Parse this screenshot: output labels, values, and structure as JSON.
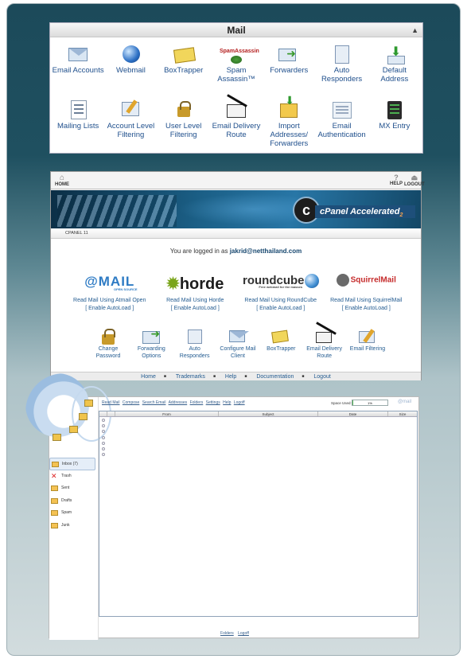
{
  "mail_panel": {
    "title": "Mail",
    "items": [
      {
        "label": "Email Accounts",
        "icon": "envelope-icon"
      },
      {
        "label": "Webmail",
        "icon": "globe-icon"
      },
      {
        "label": "BoxTrapper",
        "icon": "box-icon"
      },
      {
        "label": "Spam Assassin™",
        "icon": "spamassassin-icon",
        "icon_text": "SpamAssassin"
      },
      {
        "label": "Forwarders",
        "icon": "forward-envelope-icon"
      },
      {
        "label": "Auto Responders",
        "icon": "auto-responder-icon"
      },
      {
        "label": "Default Address",
        "icon": "download-icon"
      },
      {
        "label": "Mailing Lists",
        "icon": "mailing-list-icon"
      },
      {
        "label": "Account Level Filtering",
        "icon": "filter-pen-icon"
      },
      {
        "label": "User Level Filtering",
        "icon": "lock-icon"
      },
      {
        "label": "Email Delivery Route",
        "icon": "delivery-route-icon"
      },
      {
        "label": "Import Addresses/ Forwarders",
        "icon": "import-package-icon"
      },
      {
        "label": "Email Authentication",
        "icon": "authentication-icon"
      },
      {
        "label": "MX Entry",
        "icon": "server-icon"
      }
    ]
  },
  "webmail_chooser": {
    "home_label": "HOME",
    "help_label": "HELP",
    "logout_label": "LOGOUT",
    "banner_logo_text": "cPanel Accelerated",
    "banner_logo_sup": "2",
    "version": "CPANEL 11",
    "logged_in_prefix": "You are logged in as",
    "logged_in_user": "jakrid@netthailand.com",
    "clients": [
      {
        "logo": "@MAIL",
        "logo_sub": "OPEN SOURCE",
        "read": "Read Mail Using Atmail Open",
        "autoload": "[ Enable AutoLoad ]"
      },
      {
        "logo": "horde",
        "read": "Read Mail Using Horde",
        "autoload": "[ Enable AutoLoad ]"
      },
      {
        "logo": "roundcube",
        "logo_sub": "Free webmail for the masses",
        "read": "Read Mail Using RoundCube",
        "autoload": "[ Enable AutoLoad ]"
      },
      {
        "logo": "SquirrelMail",
        "read": "Read Mail Using SquirrelMail",
        "autoload": "[ Enable AutoLoad ]"
      }
    ],
    "tools": [
      {
        "label": "Change Password",
        "icon": "lock-icon"
      },
      {
        "label": "Forwarding Options",
        "icon": "forward-envelope-icon"
      },
      {
        "label": "Auto Responders",
        "icon": "auto-responder-icon"
      },
      {
        "label": "Configure Mail Client",
        "icon": "envelope-icon"
      },
      {
        "label": "BoxTrapper",
        "icon": "box-icon"
      },
      {
        "label": "Email Delivery Route",
        "icon": "delivery-route-icon"
      },
      {
        "label": "Email Filtering",
        "icon": "filter-pen-icon"
      }
    ],
    "footer": [
      "Home",
      "Trademarks",
      "Help",
      "Documentation",
      "Logout"
    ]
  },
  "webmail_inbox": {
    "nav": [
      "Read Mail",
      "Compose",
      "Search Email",
      "Addresses",
      "Folders",
      "Settings",
      "Help",
      "Logoff"
    ],
    "space_used_label": "Space Used:",
    "space_used_value": "1%",
    "space_used_fraction": 0.01,
    "brand": "@mail",
    "columns": [
      "From",
      "Subject",
      "Date",
      "Size"
    ],
    "folders": [
      {
        "label": "Inbox (7)",
        "selected": true
      },
      {
        "label": "Trash"
      },
      {
        "label": "Sent"
      },
      {
        "label": "Drafts"
      },
      {
        "label": "Spam"
      },
      {
        "label": "Junk"
      }
    ],
    "row_count": 7,
    "bottom_links": [
      "Folders",
      "Logoff"
    ]
  }
}
